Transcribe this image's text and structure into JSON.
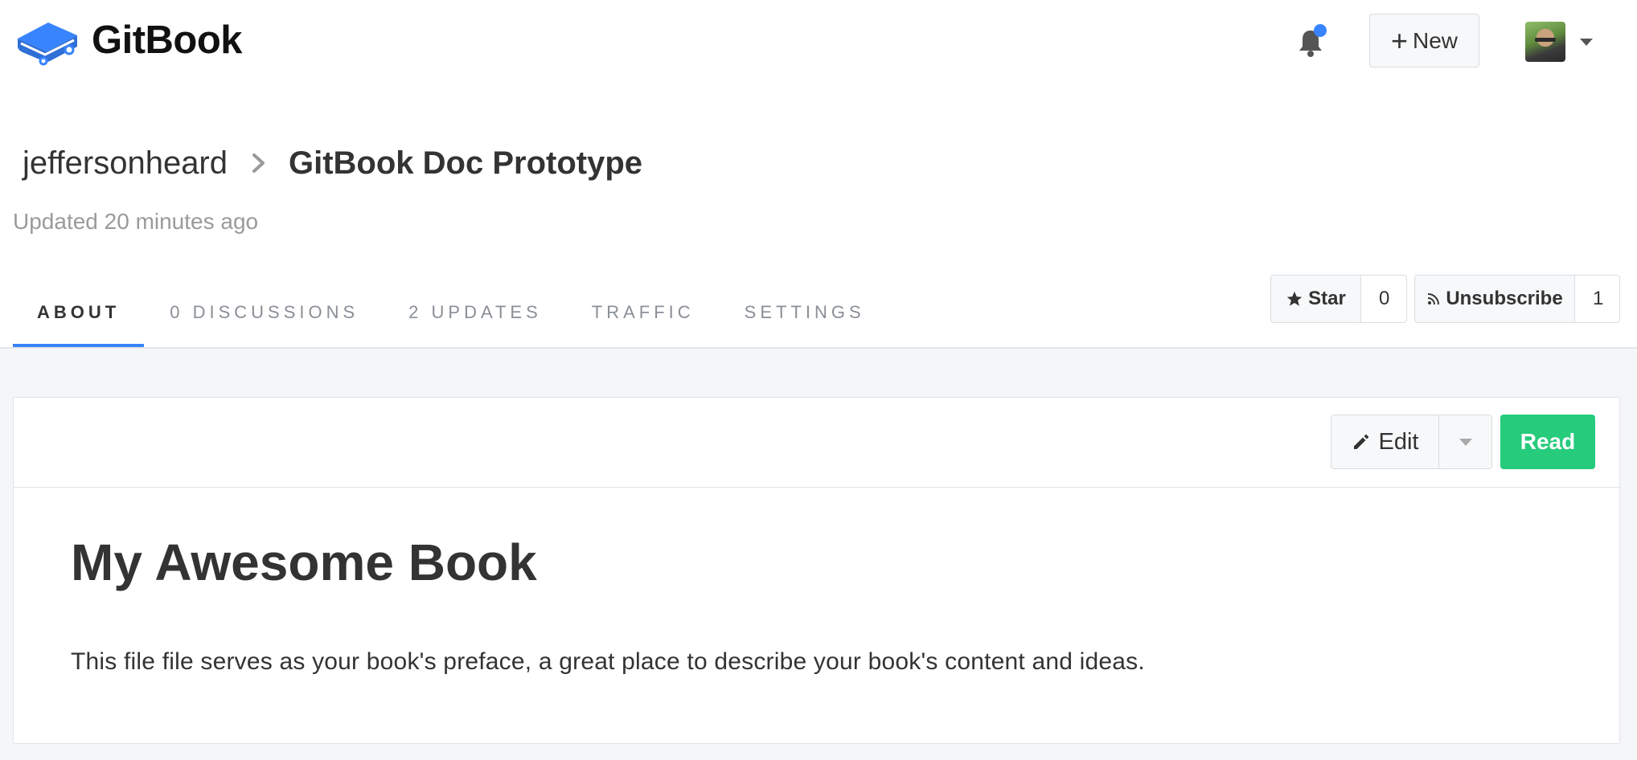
{
  "header": {
    "brand_name": "GitBook",
    "new_button_label": "New",
    "notification_indicator": true,
    "colors": {
      "accent": "#3884ff",
      "read_button": "#26cb7c"
    }
  },
  "breadcrumb": {
    "user": "jeffersonheard",
    "book": "GitBook Doc Prototype"
  },
  "meta": {
    "updated": "Updated 20 minutes ago"
  },
  "tabs": [
    {
      "label": "ABOUT",
      "active": true
    },
    {
      "label": "0 DISCUSSIONS",
      "active": false
    },
    {
      "label": "2 UPDATES",
      "active": false
    },
    {
      "label": "TRAFFIC",
      "active": false
    },
    {
      "label": "SETTINGS",
      "active": false
    }
  ],
  "actions": {
    "star_label": "Star",
    "star_count": "0",
    "unsubscribe_label": "Unsubscribe",
    "subscriber_count": "1"
  },
  "card": {
    "edit_label": "Edit",
    "read_label": "Read",
    "title": "My Awesome Book",
    "description": "This file file serves as your book's preface, a great place to describe your book's content and ideas."
  },
  "icons": {
    "logo": "book-logo-icon",
    "bell": "bell-icon",
    "plus": "plus-icon",
    "chevron": "chevron-right-icon",
    "star": "star-icon",
    "rss": "rss-icon",
    "pencil": "pencil-icon",
    "caret": "caret-down-icon"
  }
}
